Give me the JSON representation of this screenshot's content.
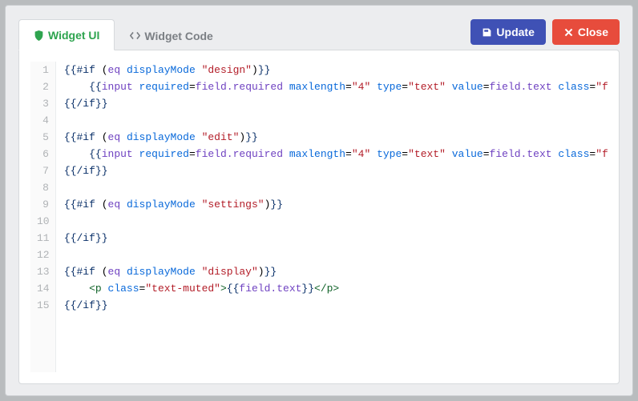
{
  "tabs": {
    "ui": {
      "label": "Widget UI",
      "icon": "shield-icon"
    },
    "code": {
      "label": "Widget Code",
      "icon": "code-icon"
    }
  },
  "buttons": {
    "update": {
      "label": "Update",
      "icon": "save-icon"
    },
    "close": {
      "label": "Close",
      "icon": "x-icon"
    }
  },
  "code_lines": [
    [
      [
        "kw",
        "{{#if"
      ],
      [
        "pl",
        " ("
      ],
      [
        "name",
        "eq"
      ],
      [
        "pl",
        " "
      ],
      [
        "attr",
        "displayMode"
      ],
      [
        "pl",
        " "
      ],
      [
        "str",
        "\"design\""
      ],
      [
        "pl",
        ")"
      ],
      [
        "kw",
        "}}"
      ]
    ],
    [
      [
        "pl",
        "    "
      ],
      [
        "kw",
        "{{"
      ],
      [
        "name",
        "input"
      ],
      [
        "pl",
        " "
      ],
      [
        "attr",
        "required"
      ],
      [
        "pl",
        "="
      ],
      [
        "name",
        "field.required"
      ],
      [
        "pl",
        " "
      ],
      [
        "attr",
        "maxlength"
      ],
      [
        "pl",
        "="
      ],
      [
        "str",
        "\"4\""
      ],
      [
        "pl",
        " "
      ],
      [
        "attr",
        "type"
      ],
      [
        "pl",
        "="
      ],
      [
        "str",
        "\"text\""
      ],
      [
        "pl",
        " "
      ],
      [
        "attr",
        "value"
      ],
      [
        "pl",
        "="
      ],
      [
        "name",
        "field.text"
      ],
      [
        "pl",
        " "
      ],
      [
        "attr",
        "class"
      ],
      [
        "pl",
        "="
      ],
      [
        "str",
        "\"form-control\""
      ],
      [
        "kw",
        "}}"
      ]
    ],
    [
      [
        "kw",
        "{{/if}}"
      ]
    ],
    [],
    [
      [
        "kw",
        "{{#if"
      ],
      [
        "pl",
        " ("
      ],
      [
        "name",
        "eq"
      ],
      [
        "pl",
        " "
      ],
      [
        "attr",
        "displayMode"
      ],
      [
        "pl",
        " "
      ],
      [
        "str",
        "\"edit\""
      ],
      [
        "pl",
        ")"
      ],
      [
        "kw",
        "}}"
      ]
    ],
    [
      [
        "pl",
        "    "
      ],
      [
        "kw",
        "{{"
      ],
      [
        "name",
        "input"
      ],
      [
        "pl",
        " "
      ],
      [
        "attr",
        "required"
      ],
      [
        "pl",
        "="
      ],
      [
        "name",
        "field.required"
      ],
      [
        "pl",
        " "
      ],
      [
        "attr",
        "maxlength"
      ],
      [
        "pl",
        "="
      ],
      [
        "str",
        "\"4\""
      ],
      [
        "pl",
        " "
      ],
      [
        "attr",
        "type"
      ],
      [
        "pl",
        "="
      ],
      [
        "str",
        "\"text\""
      ],
      [
        "pl",
        " "
      ],
      [
        "attr",
        "value"
      ],
      [
        "pl",
        "="
      ],
      [
        "name",
        "field.text"
      ],
      [
        "pl",
        " "
      ],
      [
        "attr",
        "class"
      ],
      [
        "pl",
        "="
      ],
      [
        "str",
        "\"form-control\""
      ],
      [
        "kw",
        "}}"
      ]
    ],
    [
      [
        "kw",
        "{{/if}}"
      ]
    ],
    [],
    [
      [
        "kw",
        "{{#if"
      ],
      [
        "pl",
        " ("
      ],
      [
        "name",
        "eq"
      ],
      [
        "pl",
        " "
      ],
      [
        "attr",
        "displayMode"
      ],
      [
        "pl",
        " "
      ],
      [
        "str",
        "\"settings\""
      ],
      [
        "pl",
        ")"
      ],
      [
        "kw",
        "}}"
      ]
    ],
    [],
    [
      [
        "kw",
        "{{/if}}"
      ]
    ],
    [],
    [
      [
        "kw",
        "{{#if"
      ],
      [
        "pl",
        " ("
      ],
      [
        "name",
        "eq"
      ],
      [
        "pl",
        " "
      ],
      [
        "attr",
        "displayMode"
      ],
      [
        "pl",
        " "
      ],
      [
        "str",
        "\"display\""
      ],
      [
        "pl",
        ")"
      ],
      [
        "kw",
        "}}"
      ]
    ],
    [
      [
        "pl",
        "    "
      ],
      [
        "tag",
        "<p"
      ],
      [
        "pl",
        " "
      ],
      [
        "attr",
        "class"
      ],
      [
        "pl",
        "="
      ],
      [
        "str",
        "\"text-muted\""
      ],
      [
        "tag",
        ">"
      ],
      [
        "kw",
        "{{"
      ],
      [
        "name",
        "field.text"
      ],
      [
        "kw",
        "}}"
      ],
      [
        "tag",
        "</p>"
      ]
    ],
    [
      [
        "kw",
        "{{/if}}"
      ]
    ]
  ]
}
